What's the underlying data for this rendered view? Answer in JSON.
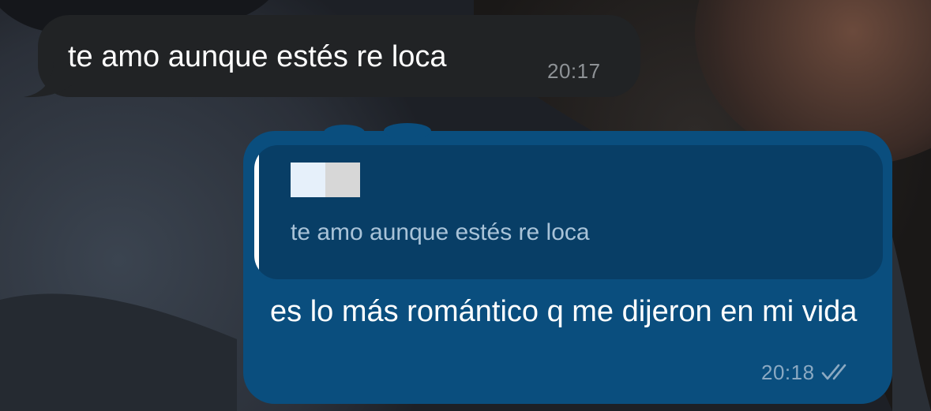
{
  "chat": {
    "incoming_message": {
      "text": "te amo aunque estés re loca",
      "time": "20:17"
    },
    "outgoing_message": {
      "reply_quote": {
        "author": "",
        "text": "te amo aunque estés re loca"
      },
      "text": "es lo más romántico q me dijeron en mi vida",
      "time": "20:18",
      "status_icon": "double-check-read-icon"
    }
  },
  "colors": {
    "incoming_bubble": "#212325",
    "outgoing_bubble": "#0a4e7e",
    "reply_preview": "#083e66",
    "timestamp_incoming": "#8e9296",
    "timestamp_outgoing": "#8ba9c2"
  }
}
